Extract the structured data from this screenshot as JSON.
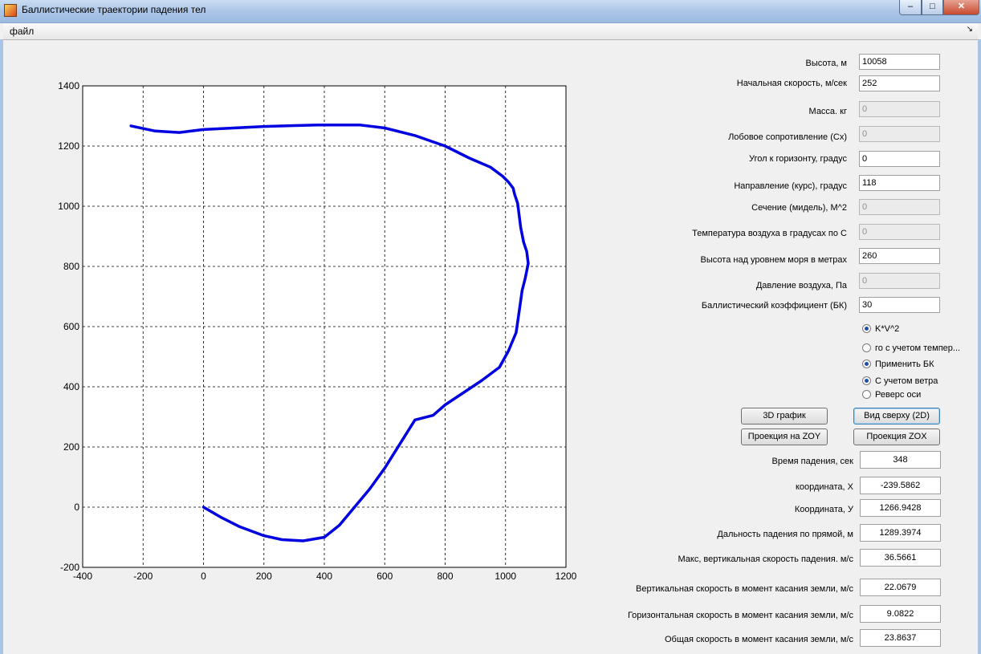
{
  "window": {
    "title": "Баллистические траектории падения тел",
    "minimize_glyph": "–",
    "maximize_glyph": "□",
    "close_glyph": "✕"
  },
  "menu": {
    "file_label": "файл",
    "dock_glyph": "↘"
  },
  "chart_data": {
    "type": "line",
    "xlim": [
      -400,
      1200
    ],
    "ylim": [
      -200,
      1400
    ],
    "xticks": [
      -400,
      -200,
      0,
      200,
      400,
      600,
      800,
      1000,
      1200
    ],
    "yticks": [
      -200,
      0,
      200,
      400,
      600,
      800,
      1000,
      1200,
      1400
    ],
    "grid": true,
    "line_color": "#0000e0",
    "series": [
      {
        "x": [
          0,
          60,
          120,
          200,
          260,
          330,
          400,
          450,
          500,
          550,
          600,
          650,
          700,
          760,
          800,
          860,
          920,
          980,
          1010,
          1035,
          1045,
          1055,
          1065,
          1075,
          1070,
          1060,
          1050,
          1045,
          1040,
          1030,
          1025,
          1010,
          990,
          950,
          880,
          800,
          700,
          600,
          520,
          440,
          380,
          300,
          200,
          100,
          0,
          -80,
          -160,
          -240
        ],
        "y": [
          0,
          -35,
          -65,
          -95,
          -108,
          -112,
          -100,
          -60,
          0,
          60,
          130,
          210,
          290,
          305,
          340,
          380,
          420,
          465,
          520,
          580,
          650,
          720,
          760,
          810,
          850,
          880,
          930,
          970,
          1010,
          1040,
          1060,
          1080,
          1100,
          1130,
          1160,
          1200,
          1235,
          1260,
          1270,
          1270,
          1270,
          1268,
          1265,
          1260,
          1255,
          1245,
          1250,
          1267
        ]
      }
    ]
  },
  "fields": [
    {
      "label": "Высота, м",
      "value": "10058",
      "enabled": true
    },
    {
      "label": "Начальная скорость, м/сек",
      "value": "252",
      "enabled": true
    },
    {
      "label": "Масса. кг",
      "value": "0",
      "enabled": false
    },
    {
      "label": "Лобовое сопротивление (Cx)",
      "value": "0",
      "enabled": false
    },
    {
      "label": "Угол к горизонту, градус",
      "value": "0",
      "enabled": true
    },
    {
      "label": "Направление  (курс), градус",
      "value": "118",
      "enabled": true
    },
    {
      "label": "Сечение (мидель), М^2",
      "value": "0",
      "enabled": false
    },
    {
      "label": "Температура воздуха в градусах по С",
      "value": "0",
      "enabled": false
    },
    {
      "label": "Высота над уровнем моря в метрах",
      "value": "260",
      "enabled": true
    },
    {
      "label": "Давление воздуха, Па",
      "value": "0",
      "enabled": false
    },
    {
      "label": "Баллистический коэффициент (БК)",
      "value": "30",
      "enabled": true
    }
  ],
  "options": [
    {
      "label": "K*V^2",
      "checked": true
    },
    {
      "label": "го с учетом темпер...",
      "checked": false
    },
    {
      "label": "Применить БК",
      "checked": true
    },
    {
      "label": "С учетом ветра",
      "checked": true
    },
    {
      "label": "Реверс оси",
      "checked": false
    }
  ],
  "buttons": {
    "plot3d": "3D график",
    "top_view": "Вид сверху (2D)",
    "proj_zoy": "Проекция на ZOY",
    "proj_zox": "Проекция ZOX"
  },
  "results": [
    {
      "label": "Время падения, сек",
      "value": "348"
    },
    {
      "label": "координата, X",
      "value": "-239.5862"
    },
    {
      "label": "Координата, У",
      "value": "1266.9428"
    },
    {
      "label": "Дальность падения по прямой, м",
      "value": "1289.3974"
    },
    {
      "label": "Макс,  вертикальная скорость падения. м/с",
      "value": "36.5661"
    },
    {
      "label": "Вертикальная  скорость в момент касания земли, м/с",
      "value": "22.0679"
    },
    {
      "label": "Горизонтальная скорость в момент касания земли, м/с",
      "value": "9.0822"
    },
    {
      "label": "Общая скорость в момент касания земли, м/с",
      "value": "23.8637"
    }
  ]
}
